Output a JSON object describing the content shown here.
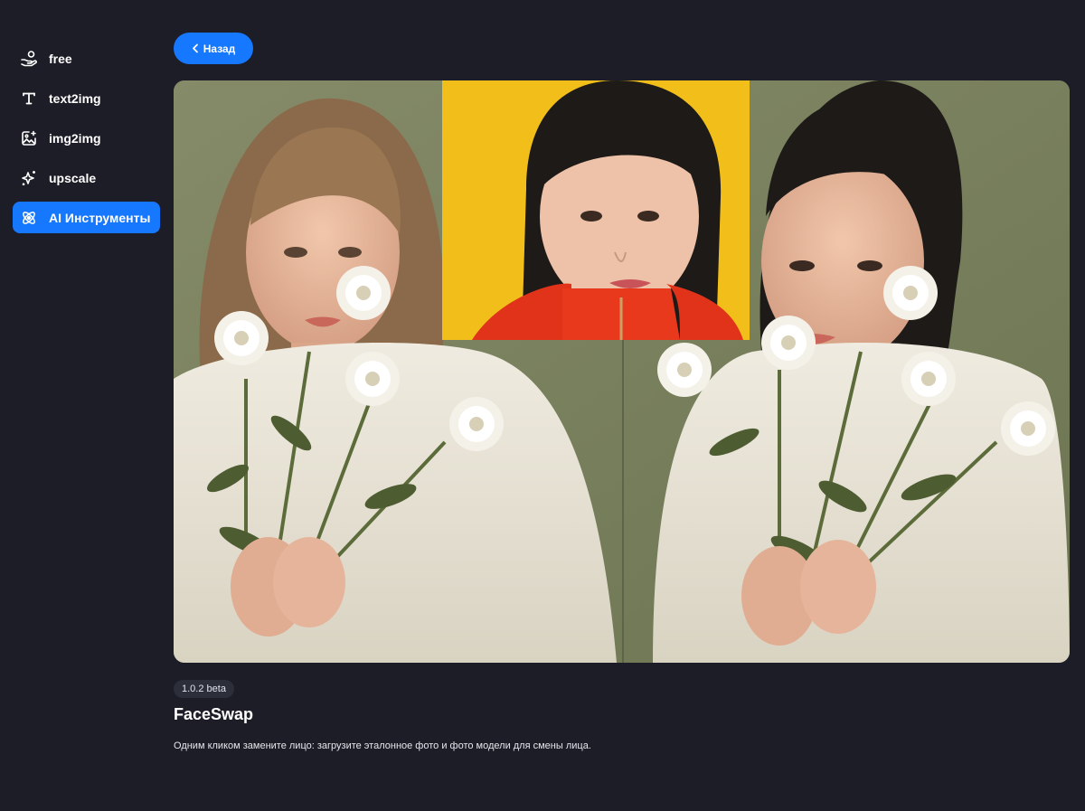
{
  "sidebar": {
    "items": [
      {
        "label": "free",
        "icon": "hand-coin-icon",
        "active": false
      },
      {
        "label": "text2img",
        "icon": "text-t-icon",
        "active": false
      },
      {
        "label": "img2img",
        "icon": "image-sparkle-icon",
        "active": false
      },
      {
        "label": "upscale",
        "icon": "sparkles-icon",
        "active": false
      },
      {
        "label": "AI Инструменты",
        "icon": "atom-icon",
        "active": true
      }
    ]
  },
  "header": {
    "back_label": "Назад"
  },
  "tool": {
    "version": "1.0.2 beta",
    "title": "FaceSwap",
    "description": "Одним кликом замените лицо: загрузите эталонное фото и фото модели для смены лица."
  },
  "colors": {
    "background": "#1c1d26",
    "accent": "#1677ff",
    "badge_bg": "#2c2e39"
  }
}
